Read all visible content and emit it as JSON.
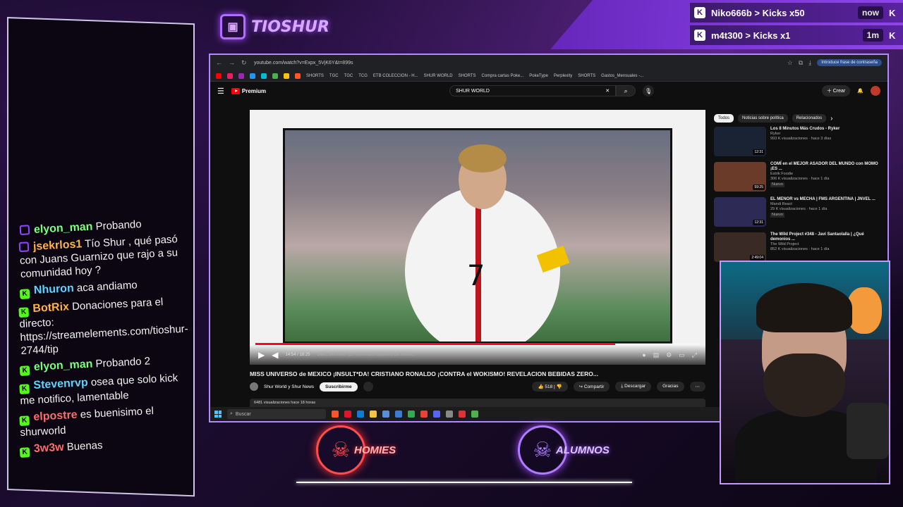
{
  "overlay": {
    "brand_name": "TIOSHUR",
    "alerts": [
      {
        "user": "Niko666b",
        "action": "Kicks x50",
        "time": "now"
      },
      {
        "user": "m4t300",
        "action": "Kicks x1",
        "time": "1m"
      }
    ],
    "badges": {
      "homies": "HOMIES",
      "alumnos": "ALUMNOS"
    }
  },
  "chat": [
    {
      "platform": "twitch",
      "user": "elyon_man",
      "color": "#7CFF7C",
      "text": "Probando"
    },
    {
      "platform": "twitch",
      "user": "jsekrlos1",
      "color": "#FFB347",
      "text": "Tío Shur , qué pasó con Juans Guarnizo que rajo a su comunidad hoy ?"
    },
    {
      "platform": "kick",
      "user": "Nhuron",
      "color": "#5FD3FF",
      "text": "aca andiamo"
    },
    {
      "platform": "kick",
      "user": "BotRix",
      "color": "#FFB347",
      "text": "Donaciones para el directo: https://streamelements.com/tioshur-2744/tip"
    },
    {
      "platform": "kick",
      "user": "elyon_man",
      "color": "#7CFF7C",
      "text": "Probando 2"
    },
    {
      "platform": "kick",
      "user": "Stevenrvp",
      "color": "#5FD3FF",
      "text": "osea que solo kick me notifico, lamentable"
    },
    {
      "platform": "kick",
      "user": "elpostre",
      "color": "#FF6B6B",
      "text": "es buenisimo el shurworld"
    },
    {
      "platform": "kick",
      "user": "3w3w",
      "color": "#FF6B6B",
      "text": "Buenas"
    }
  ],
  "browser": {
    "url": "youtube.com/watch?v=Expx_5VjK6Y&t=899s",
    "password_chip": "Introduce frase de contraseña",
    "bookmarks": [
      "SHORTS",
      "TGC",
      "TGC",
      "TCG",
      "ETB COLECCION - H...",
      "SHUR WORLD",
      "SHORTS",
      "Compra cartas Poke...",
      "PokeType",
      "Perplexity",
      "SHORTS",
      "Gastos_Mensuales -..."
    ]
  },
  "youtube": {
    "logo_text": "Premium",
    "search_value": "SHUR WORLD",
    "create_label": "Crear",
    "notifications": "9+",
    "player": {
      "time": "14:54 / 18:25",
      "chapter": "David Beckham ¡Es nombrado caballero del Reino...",
      "progress": 0.81
    },
    "video_title": "MISS UNIVERSO de MEXICO ¡INSULT*DA! CRISTIANO RONALDO ¡CONTRA el WOKISMO! REVELACION BEBIDAS ZERO...",
    "channel": "Shur World y Shur News",
    "subscribe_label": "Suscribirme",
    "likes": "518",
    "share_label": "Compartir",
    "download_label": "Descargar",
    "thanks_label": "Gracias",
    "description": "6481 visualizaciones  hace 18 horas",
    "chips": [
      "Todos",
      "Noticias sobre política",
      "Relacionados"
    ],
    "recommendations": [
      {
        "title": "Los 8 Minutos Más Crudos - Ryker",
        "channel": "Ryker",
        "meta": "993 K visualizaciones · hace 3 días",
        "duration": "12:31",
        "tag": "",
        "color": "#1a2333"
      },
      {
        "title": "COMÍ en el MEJOR ASADOR DEL MUNDO con MOMO ¡ES ...",
        "channel": "Estrik Foodie",
        "meta": "306 K visualizaciones · hace 1 día",
        "duration": "59:25",
        "tag": "Nuevo",
        "color": "#6b3b2a"
      },
      {
        "title": "EL MENOR vs MECHA | FMS ARGENTINA | JNVEL ...",
        "channel": "Mandi React",
        "meta": "29 K visualizaciones · hace 1 día",
        "duration": "12:31",
        "tag": "Nuevo",
        "color": "#2d2a55"
      },
      {
        "title": "The Wild Project #348 - Javi Santaolalla | ¿Qué demonios ...",
        "channel": "The Wild Project",
        "meta": "852 K visualizaciones · hace 1 día",
        "duration": "2:49:04",
        "tag": "",
        "color": "#3a2a25"
      }
    ]
  },
  "taskbar": {
    "search_placeholder": "Buscar"
  }
}
